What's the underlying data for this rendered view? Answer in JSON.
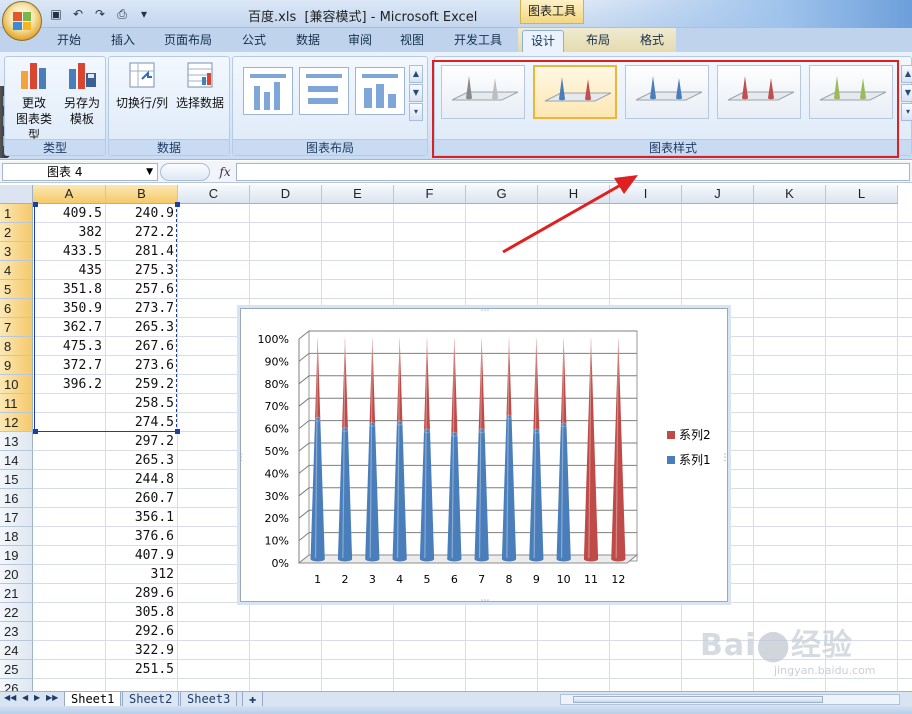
{
  "window": {
    "title": "百度.xls  [兼容模式] - Microsoft Excel",
    "context_label": "图表工具"
  },
  "tabs": [
    "开始",
    "插入",
    "页面布局",
    "公式",
    "数据",
    "审阅",
    "视图",
    "开发工具",
    "设计",
    "布局",
    "格式"
  ],
  "active_tab": "设计",
  "ribbon": {
    "type_group": {
      "label": "类型",
      "change_type": "更改\n图表类型",
      "save_template": "另存为\n模板"
    },
    "data_group": {
      "label": "数据",
      "switch_row_col": "切换行/列",
      "select_data": "选择数据"
    },
    "layout_group": {
      "label": "图表布局"
    },
    "styles_group": {
      "label": "图表样式",
      "selected_index": 1
    }
  },
  "formula_bar": {
    "name_box": "图表 4",
    "fx_label": "fx",
    "value": ""
  },
  "grid": {
    "columns": [
      "A",
      "B",
      "C",
      "D",
      "E",
      "F",
      "G",
      "H",
      "I",
      "J",
      "K",
      "L"
    ],
    "rows": [
      "1",
      "2",
      "3",
      "4",
      "5",
      "6",
      "7",
      "8",
      "9",
      "10",
      "11",
      "12",
      "13",
      "14",
      "15",
      "16",
      "17",
      "18",
      "19",
      "20",
      "21",
      "22",
      "23",
      "24",
      "25",
      "26"
    ],
    "col_a": [
      "409.5",
      "382",
      "433.5",
      "435",
      "351.8",
      "350.9",
      "362.7",
      "475.3",
      "372.7",
      "396.2",
      "",
      "",
      "",
      "",
      "",
      "",
      "",
      "",
      "",
      "",
      "",
      "",
      "",
      "",
      "",
      ""
    ],
    "col_b": [
      "240.9",
      "272.2",
      "281.4",
      "275.3",
      "257.6",
      "273.7",
      "265.3",
      "267.6",
      "273.6",
      "259.2",
      "258.5",
      "274.5",
      "297.2",
      "265.3",
      "244.8",
      "260.7",
      "356.1",
      "376.6",
      "407.9",
      "312",
      "289.6",
      "305.8",
      "292.6",
      "322.9",
      "251.5",
      ""
    ]
  },
  "chart_data": {
    "type": "bar",
    "stacking": "percent",
    "shape": "3d-cone",
    "categories": [
      "1",
      "2",
      "3",
      "4",
      "5",
      "6",
      "7",
      "8",
      "9",
      "10",
      "11",
      "12"
    ],
    "series": [
      {
        "name": "系列1",
        "color": "#4a7ebb",
        "values": [
          409.5,
          382,
          433.5,
          435,
          351.8,
          350.9,
          362.7,
          475.3,
          372.7,
          396.2,
          0,
          0
        ]
      },
      {
        "name": "系列2",
        "color": "#be4b48",
        "values": [
          240.9,
          272.2,
          281.4,
          275.3,
          257.6,
          273.7,
          265.3,
          267.6,
          273.6,
          259.2,
          258.5,
          274.5
        ]
      }
    ],
    "y_ticks": [
      "0%",
      "10%",
      "20%",
      "30%",
      "40%",
      "50%",
      "60%",
      "70%",
      "80%",
      "90%",
      "100%"
    ],
    "ylim": [
      0,
      100
    ],
    "grid": true,
    "legend_position": "right"
  },
  "sheets": [
    "Sheet1",
    "Sheet2",
    "Sheet3"
  ],
  "active_sheet": "Sheet1",
  "watermark": {
    "text": "Bai du 经验",
    "sub": "jingyan.baidu.com"
  },
  "colors": {
    "highlight": "#e02020",
    "arrow": "#e02020",
    "selection": "#1d3f9e"
  }
}
